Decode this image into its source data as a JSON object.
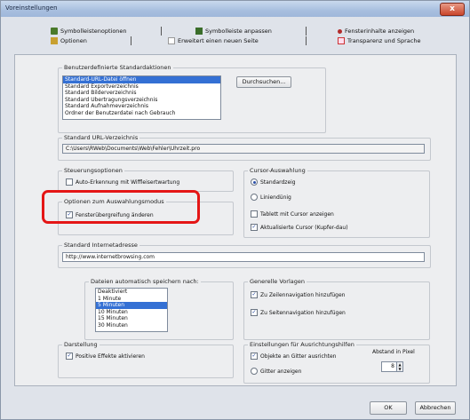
{
  "window": {
    "title": "Voreinstellungen",
    "close_symbol": "x"
  },
  "tabs": [
    {
      "label": "Symbolleistenoptionen",
      "icon": "toolbar-icon",
      "color": "#4a7a2a"
    },
    {
      "label": "Symbolleiste anpassen",
      "icon": "customize-icon",
      "color": "#3a6d2a"
    },
    {
      "label": "Fensterinhalte anzeigen",
      "icon": "windows-icon",
      "color": "#b22b2b"
    },
    {
      "label": "Optionen",
      "icon": "options-icon",
      "color": "#c8a030"
    },
    {
      "label": "Erweitert einen neuen Seite",
      "icon": "page-icon",
      "color": "#999999"
    },
    {
      "label": "Transparenz und Sprache",
      "icon": "language-icon",
      "color": "#cc3333"
    }
  ],
  "standard_actions": {
    "legend": "Benutzerdefinierte Standardaktionen",
    "items": [
      "Standard-URL-Datei öffnen",
      "Standard Exportverzeichnis",
      "Standard Bilderverzeichnis",
      "Standard Übertragungsverzeichnis",
      "Standard Aufnahmeverzeichnis",
      "Ordner der Benutzerdatei nach Gebrauch"
    ],
    "selected_index": 0,
    "button": "Durchsuchen..."
  },
  "standard_url": {
    "legend": "Standard URL-Verzeichnis",
    "value": "C:\\Users\\RWeb\\Documents\\Web\\Fehler\\Uhrzeit.pro"
  },
  "steuerung": {
    "legend": "Steuerungsoptionen",
    "option": "Auto-Erkennung mit Wiffleisertwartung",
    "checked": false
  },
  "cursor": {
    "legend": "Cursor-Auswahlung",
    "radio1": "Standardzeig",
    "radio2": "Liniendünig",
    "check1": "Tablett mit Cursor anzeigen",
    "check2": "Aktualisierte Cursor (Kupfer-dau)",
    "radio1_on": true,
    "radio2_on": false,
    "check1_on": false,
    "check2_on": true
  },
  "fenster_opts": {
    "legend": "Optionen zum Auswahlungsmodus",
    "option": "Fensterübergreifung änderen",
    "checked": true
  },
  "homepage": {
    "legend": "Standard Internetadresse",
    "value": "http://www.internetbrowsing.com"
  },
  "autosave": {
    "legend": "Dateien automatisch speichern nach:",
    "items": [
      "Deaktiviert",
      "1 Minute",
      "5 Minuten",
      "10 Minuten",
      "15 Minuten",
      "30 Minuten"
    ],
    "selected_index": 2
  },
  "general": {
    "legend": "Generelle Vorlagen",
    "check1": "Zu Zeilennavigation hinzufügen",
    "check2": "Zu Seitennavigation hinzufügen",
    "check1_on": true,
    "check2_on": true
  },
  "anzeige": {
    "legend": "Darstellung",
    "option": "Positive Effekte aktivieren",
    "checked": true
  },
  "print": {
    "legend": "Einstellungen für Ausrichtungshilfen",
    "check1": "Objekte an Gitter ausrichten",
    "radio1": "Gitter anzeigen",
    "check1_on": true,
    "radio1_on": false,
    "spacing_label": "Abstand in Pixel",
    "spacing_value": "8"
  },
  "buttons": {
    "ok": "OK",
    "cancel": "Abbrechen"
  }
}
